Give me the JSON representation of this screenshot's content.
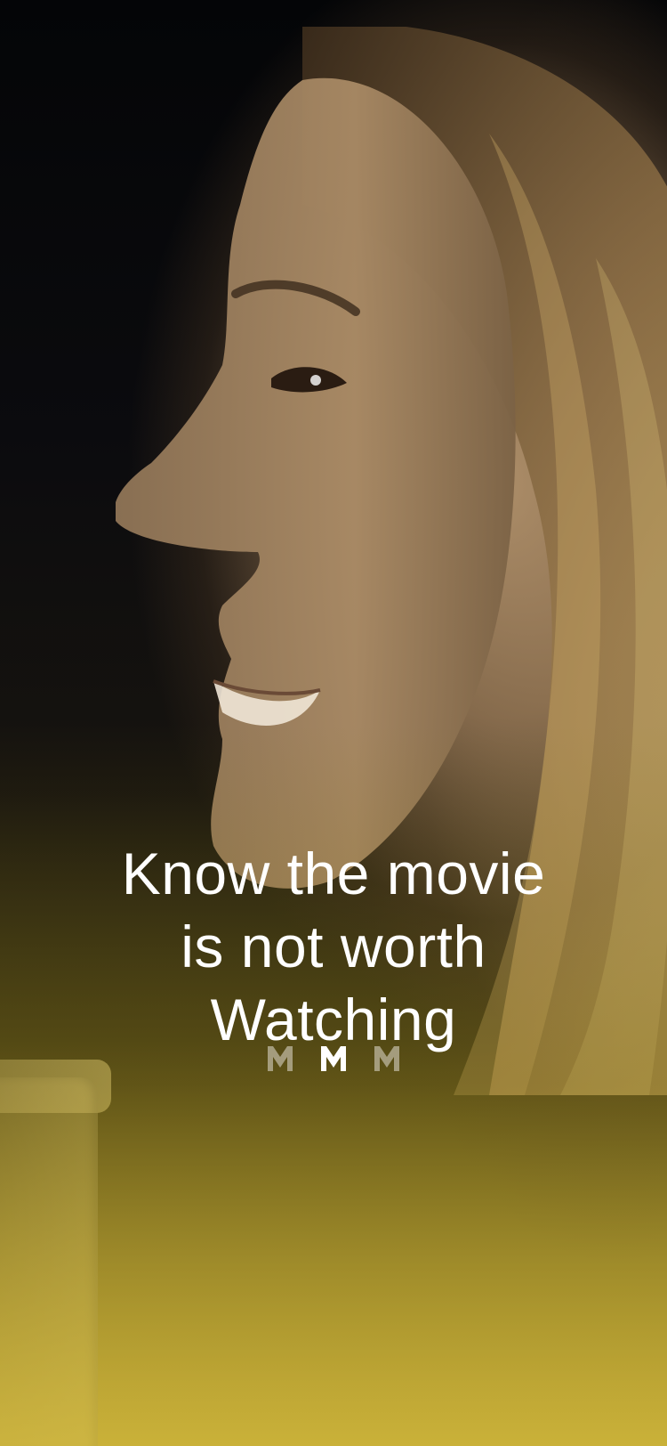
{
  "onboarding": {
    "headline_lines": [
      "Know the movie",
      "is not worth",
      "Watching"
    ],
    "pager": {
      "total": 3,
      "active_index": 1,
      "icon": "m-logo-icon"
    }
  },
  "colors": {
    "accent": "#C9B03D",
    "text": "#FFFFFF",
    "pager_active": "#FFFFFF",
    "pager_inactive": "#BDB7A0"
  }
}
